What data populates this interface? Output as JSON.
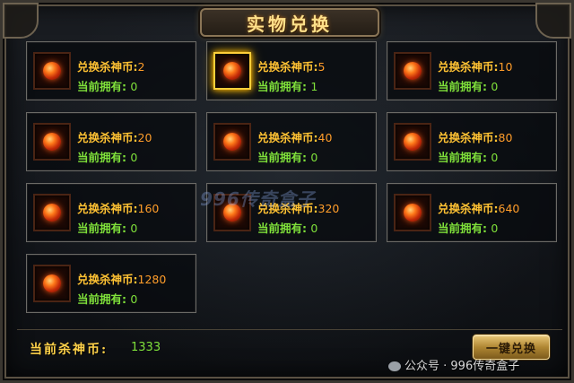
{
  "title": "实物兑换",
  "item_label": "兑换杀神币:",
  "owned_label": "当前拥有:",
  "items": [
    {
      "cost": "2",
      "owned": "0",
      "selected": false
    },
    {
      "cost": "5",
      "owned": "1",
      "selected": true
    },
    {
      "cost": "10",
      "owned": "0",
      "selected": false
    },
    {
      "cost": "20",
      "owned": "0",
      "selected": false
    },
    {
      "cost": "40",
      "owned": "0",
      "selected": false
    },
    {
      "cost": "80",
      "owned": "0",
      "selected": false
    },
    {
      "cost": "160",
      "owned": "0",
      "selected": false
    },
    {
      "cost": "320",
      "owned": "0",
      "selected": false
    },
    {
      "cost": "640",
      "owned": "0",
      "selected": false
    },
    {
      "cost": "1280",
      "owned": "0",
      "selected": false
    }
  ],
  "watermark": "996传奇盒子",
  "balance": {
    "label": "当前杀神币:",
    "value": "1333"
  },
  "exchange_all_button": "一键兑换",
  "footer_credit": "公众号 · 996传奇盒子",
  "icons": {
    "item": "fire-orb-icon",
    "footer": "wechat-icon"
  },
  "colors": {
    "label_gold": "#ffc233",
    "owned_green": "#7fe03a",
    "selected_glow": "#ffcf3a"
  }
}
